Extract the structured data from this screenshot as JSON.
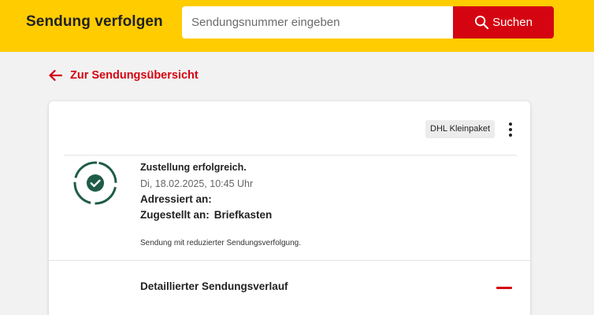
{
  "header": {
    "title": "Sendung verfolgen",
    "search_placeholder": "Sendungsnummer eingeben",
    "search_button_label": "Suchen"
  },
  "back_link": {
    "label": "Zur Sendungsübersicht"
  },
  "shipment": {
    "product_badge": "DHL Kleinpaket",
    "status_title": "Zustellung erfolgreich.",
    "status_datetime": "Di, 18.02.2025, 10:45 Uhr",
    "addressed_label": "Adressiert an:",
    "delivered_label": "Zugestellt an:",
    "delivered_value": "Briefkasten",
    "note": "Sendung mit reduzierter Sendungsverfolgung.",
    "history_title": "Detaillierter Sendungsverlauf"
  },
  "colors": {
    "brand_yellow": "#ffcc00",
    "brand_red": "#d40511",
    "success_green": "#1f5c46"
  },
  "icons": {
    "search": "search-icon",
    "back": "arrow-left-icon",
    "more": "more-vertical-icon",
    "status": "check-circle-icon",
    "collapse": "minus-icon"
  }
}
